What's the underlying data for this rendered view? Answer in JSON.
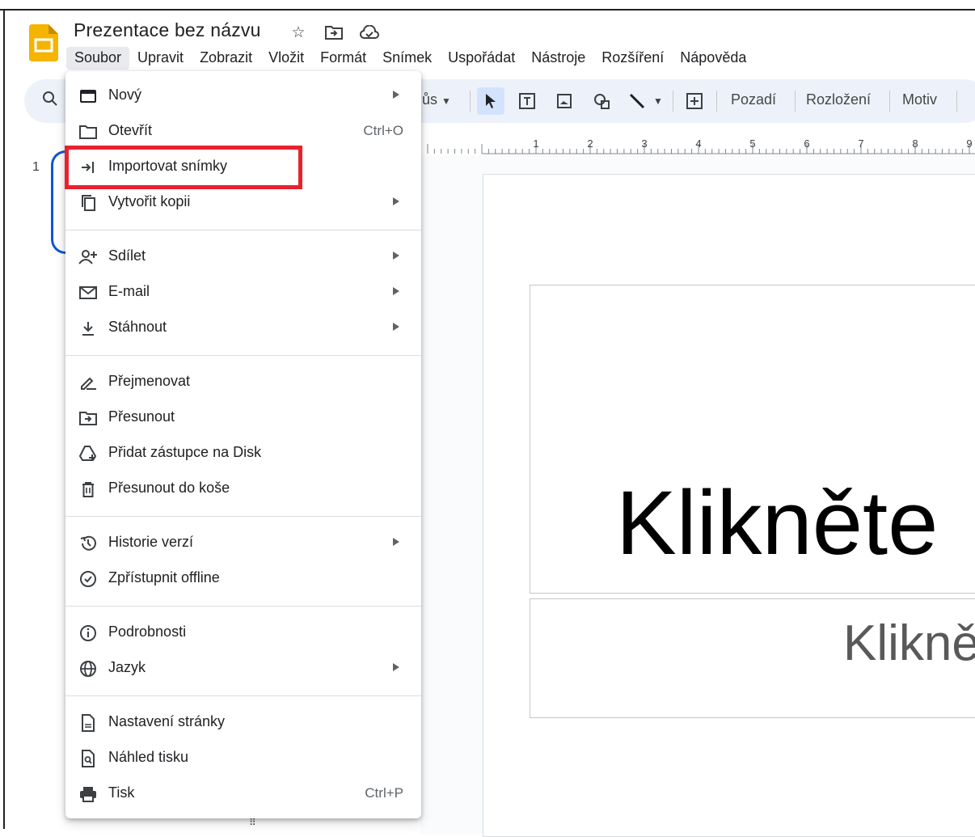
{
  "app": {
    "title": "Prezentace bez názvu",
    "accent": "#f4b400"
  },
  "menubar": [
    "Soubor",
    "Upravit",
    "Zobrazit",
    "Vložit",
    "Formát",
    "Snímek",
    "Uspořádat",
    "Nástroje",
    "Rozšíření",
    "Nápověda"
  ],
  "toolbar": {
    "partial_label": "ůs",
    "background_label": "Pozadí",
    "layout_label": "Rozložení",
    "theme_label": "Motiv"
  },
  "ruler_marks": [
    "1",
    "2",
    "3",
    "4",
    "5",
    "6",
    "7",
    "8",
    "9"
  ],
  "filmstrip": {
    "slide_number": "1"
  },
  "slide": {
    "title_placeholder": "Klikněte",
    "subtitle_placeholder": "Klikně"
  },
  "file_menu": {
    "groups": [
      [
        {
          "label": "Nový",
          "icon": "new-slides-icon",
          "submenu": true
        },
        {
          "label": "Otevřít",
          "icon": "folder-icon",
          "shortcut": "Ctrl+O"
        },
        {
          "label": "Importovat snímky",
          "icon": "import-icon",
          "highlighted": true
        },
        {
          "label": "Vytvořit kopii",
          "icon": "copy-icon",
          "submenu": true
        }
      ],
      [
        {
          "label": "Sdílet",
          "icon": "share-person-icon",
          "submenu": true
        },
        {
          "label": "E-mail",
          "icon": "email-icon",
          "submenu": true
        },
        {
          "label": "Stáhnout",
          "icon": "download-icon",
          "submenu": true
        }
      ],
      [
        {
          "label": "Přejmenovat",
          "icon": "rename-icon"
        },
        {
          "label": "Přesunout",
          "icon": "move-folder-icon"
        },
        {
          "label": "Přidat zástupce na Disk",
          "icon": "drive-shortcut-icon"
        },
        {
          "label": "Přesunout do koše",
          "icon": "trash-icon"
        }
      ],
      [
        {
          "label": "Historie verzí",
          "icon": "history-icon",
          "submenu": true
        },
        {
          "label": "Zpřístupnit offline",
          "icon": "offline-icon"
        }
      ],
      [
        {
          "label": "Podrobnosti",
          "icon": "info-icon"
        },
        {
          "label": "Jazyk",
          "icon": "globe-icon",
          "submenu": true
        }
      ],
      [
        {
          "label": "Nastavení stránky",
          "icon": "page-setup-icon"
        },
        {
          "label": "Náhled tisku",
          "icon": "print-preview-icon"
        },
        {
          "label": "Tisk",
          "icon": "printer-icon",
          "shortcut": "Ctrl+P"
        }
      ]
    ]
  },
  "colors": {
    "highlight_border": "#e8212d",
    "toolbar_bg": "#edf2fa",
    "selection_blue": "#0b57d0"
  }
}
